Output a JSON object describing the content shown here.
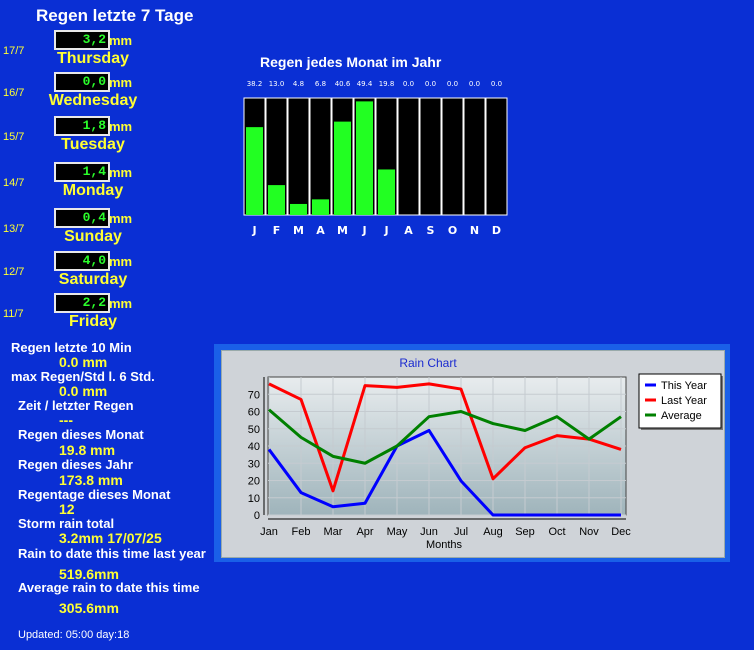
{
  "title": "Regen letzte 7 Tage",
  "days": [
    {
      "date": "17/7",
      "value": "3,2",
      "unit": "mm",
      "name": "Thursday"
    },
    {
      "date": "16/7",
      "value": "0,0",
      "unit": "mm",
      "name": "Wednesday"
    },
    {
      "date": "15/7",
      "value": "1,8",
      "unit": "mm",
      "name": "Tuesday"
    },
    {
      "date": "14/7",
      "value": "1,4",
      "unit": "mm",
      "name": "Monday"
    },
    {
      "date": "13/7",
      "value": "0,4",
      "unit": "mm",
      "name": "Sunday"
    },
    {
      "date": "12/7",
      "value": "4,0",
      "unit": "mm",
      "name": "Saturday"
    },
    {
      "date": "11/7",
      "value": "2,2",
      "unit": "mm",
      "name": "Friday"
    }
  ],
  "stats": [
    {
      "label": "Regen letzte 10 Min",
      "value": "0.0 mm"
    },
    {
      "label": "max Regen/Std l. 6 Std.",
      "value": "0.0 mm"
    },
    {
      "label": "Zeit / letzter Regen",
      "value": "---"
    },
    {
      "label": "Regen dieses Monat",
      "value": "19.8 mm"
    },
    {
      "label": "Regen dieses Jahr",
      "value": "173.8 mm"
    },
    {
      "label": "Regentage dieses Monat",
      "value": "12"
    },
    {
      "label": "Storm rain total",
      "value": "3.2mm 17/07/25"
    },
    {
      "label": "Rain to date this time last year",
      "value": "519.6mm"
    },
    {
      "label": "Average rain to date this time",
      "value": "305.6mm"
    }
  ],
  "updated": "Updated: 05:00 day:18",
  "colors": {
    "background": "#0a2fd4",
    "bar_green": "#22ff22",
    "highlight": "#ffff33",
    "this_year": "#0000ff",
    "last_year": "#ff0000",
    "average": "#008000"
  },
  "chart_data": [
    {
      "type": "bar",
      "title": "Regen jedes Monat im Jahr",
      "categories": [
        "J",
        "F",
        "M",
        "A",
        "M",
        "J",
        "J",
        "A",
        "S",
        "O",
        "N",
        "D"
      ],
      "values": [
        38.2,
        13.0,
        4.8,
        6.8,
        40.6,
        49.4,
        19.8,
        0.0,
        0.0,
        0.0,
        0.0,
        0.0
      ],
      "value_labels": [
        "38.2",
        "13.0",
        "4.8",
        "6.8",
        "40.6",
        "49.4",
        "19.8",
        "0.0",
        "0.0",
        "0.0",
        "0.0",
        "0.0"
      ],
      "ylim": [
        0,
        50
      ]
    },
    {
      "type": "line",
      "title": "Rain Chart",
      "xlabel": "Months",
      "ylabel": "",
      "categories": [
        "Jan",
        "Feb",
        "Mar",
        "Apr",
        "May",
        "Jun",
        "Jul",
        "Aug",
        "Sep",
        "Oct",
        "Nov",
        "Dec"
      ],
      "ylim": [
        0,
        80
      ],
      "yticks": [
        0,
        10,
        20,
        30,
        40,
        50,
        60,
        70
      ],
      "grid": true,
      "legend_position": "top-right",
      "series": [
        {
          "name": "This Year",
          "values": [
            38,
            13,
            4.8,
            6.8,
            40,
            49,
            19.8,
            0,
            0,
            0,
            0,
            0
          ]
        },
        {
          "name": "Last Year",
          "values": [
            76,
            67,
            14,
            75,
            74,
            76,
            73,
            21,
            39,
            46,
            44,
            38
          ]
        },
        {
          "name": "Average",
          "values": [
            61,
            45,
            34,
            30,
            40,
            57,
            60,
            53,
            49,
            57,
            44,
            57
          ]
        }
      ]
    }
  ]
}
